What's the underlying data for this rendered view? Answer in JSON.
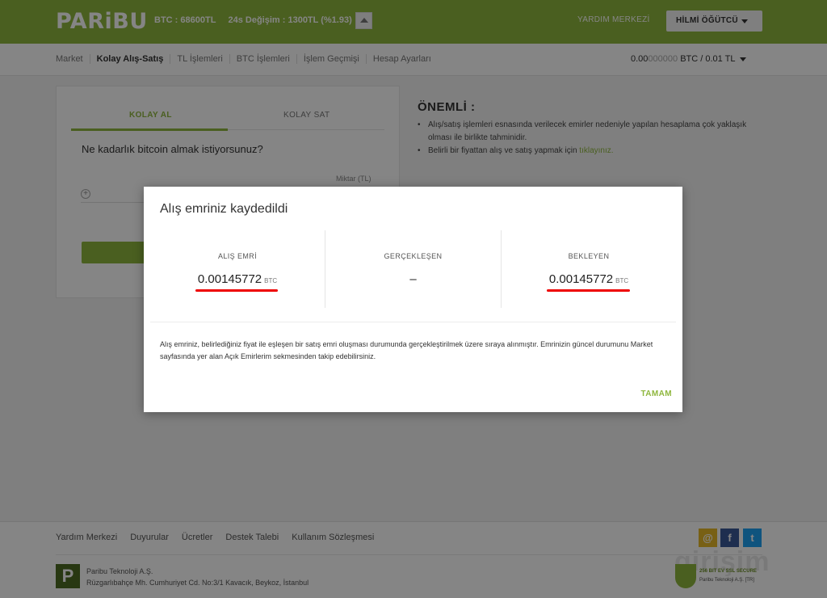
{
  "header": {
    "logo": "PARiBU",
    "btc_price": "BTC : 68600TL",
    "change": "24s Değişim : 1300TL (%1.93)",
    "help": "YARDIM MERKEZİ",
    "user": "HİLMİ ÖĞÜTCÜ"
  },
  "nav": {
    "items": [
      "Market",
      "Kolay Alış-Satış",
      "TL İşlemleri",
      "BTC İşlemleri",
      "İşlem Geçmişi",
      "Hesap Ayarları"
    ],
    "balance_strong": "0.00",
    "balance_faint": "000000",
    "balance_rest": " BTC / 0.01 TL"
  },
  "trade": {
    "tab_buy": "KOLAY AL",
    "tab_sell": "KOLAY SAT",
    "question": "Ne kadarlık bitcoin almak istiyorsunuz?",
    "amount_label": "Miktar (TL)"
  },
  "notice": {
    "title": "ÖNEMLİ :",
    "line1": "Alış/satış işlemleri esnasında verilecek emirler nedeniyle yapılan hesaplama çok yaklaşık olması ile birlikte tahminidir.",
    "line2_prefix": "Belirli bir fiyattan alış ve satış yapmak için ",
    "line2_link": "tıklayınız."
  },
  "footer": {
    "links": [
      "Yardım Merkezi",
      "Duyurular",
      "Ücretler",
      "Destek Talebi",
      "Kullanım Sözleşmesi"
    ],
    "company_name": "Paribu Teknoloji A.Ş.",
    "address": "Rüzgarlıbahçe Mh. Cumhuriyet Cd. No:3/1 Kavacık, Beykoz, İstanbul",
    "badge_line1": "256 BIT EV SSL SECURE",
    "badge_line2": "Paribu Teknoloji A.Ş. [TR]",
    "watermark": "girişim"
  },
  "modal": {
    "title": "Alış emriniz kaydedildi",
    "order_label": "ALIŞ EMRİ",
    "order_value": "0.00145772",
    "order_unit": "BTC",
    "filled_label": "GERÇEKLEŞEN",
    "filled_value": "–",
    "pending_label": "BEKLEYEN",
    "pending_value": "0.00145772",
    "pending_unit": "BTC",
    "message": "Alış emriniz, belirlediğiniz fiyat ile eşleşen bir satış emri oluşması durumunda gerçekleştirilmek üzere sıraya alınmıştır. Emrinizin güncel durumunu Market sayfasında yer alan Açık Emirlerim sekmesinden takip edebilirsiniz.",
    "ok": "TAMAM"
  },
  "colors": {
    "brand_green": "#8fb73e",
    "highlight_red": "#e00000"
  }
}
